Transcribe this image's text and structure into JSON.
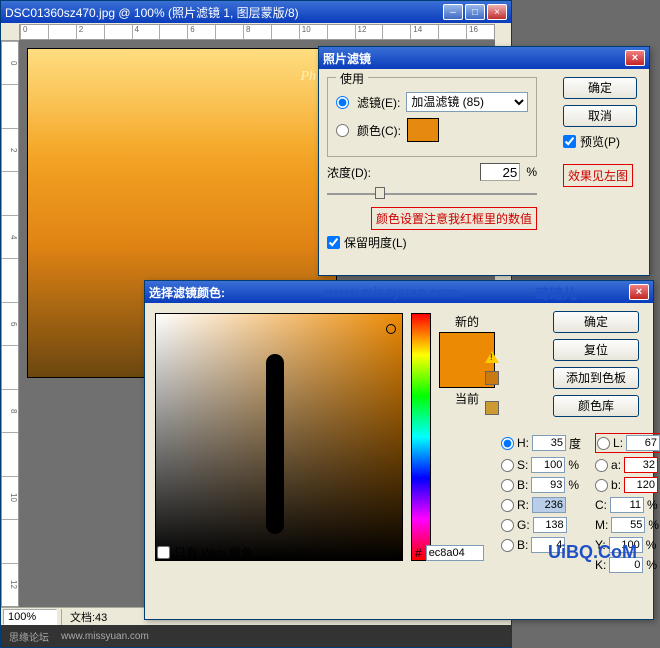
{
  "doc": {
    "title": "DSC01360sz470.jpg @ 100% (照片滤镜 1, 图层蒙版/8)",
    "zoom": "100%",
    "doc_info": "文档:43",
    "ruler_h": [
      "0",
      "",
      "2",
      "",
      "4",
      "",
      "6",
      "",
      "8",
      "",
      "10",
      "",
      "12",
      "",
      "14",
      "",
      "16"
    ],
    "ruler_v": [
      "0",
      "",
      "2",
      "",
      "4",
      "",
      "6",
      "",
      "8",
      "",
      "10",
      "",
      "12"
    ],
    "watermark": "Ph",
    "footer_left": "思缘论坛",
    "footer_right": "www.missyuan.com"
  },
  "photoFilter": {
    "title": "照片滤镜",
    "use_legend": "使用",
    "radio_filter": "滤镜(E):",
    "radio_color": "颜色(C):",
    "filter_selected": "加温滤镜 (85)",
    "density_label": "浓度(D):",
    "density_value": "25",
    "density_unit": "%",
    "preserve": "保留明度(L)",
    "ok": "确定",
    "cancel": "取消",
    "preview": "预览(P)",
    "note_effect": "效果见左图",
    "note_color": "颜色设置注意我红框里的数值"
  },
  "colorPicker": {
    "title": "选择滤镜颜色:",
    "url": "www.missyuan.com",
    "name": "琦琦儿",
    "new_label": "新的",
    "cur_label": "当前",
    "ok": "确定",
    "reset": "复位",
    "add_swatch": "添加到色板",
    "color_lib": "颜色库",
    "web_only": "只有 Web 颜色",
    "hex_label": "#",
    "hex_value": "ec8a04",
    "ubq": "UiBQ.CoM",
    "hsv": {
      "h_label": "H:",
      "h": "35",
      "h_unit": "度",
      "s_label": "S:",
      "s": "100",
      "s_unit": "%",
      "b_label": "B:",
      "b": "93",
      "b_unit": "%"
    },
    "lab": {
      "l_label": "L:",
      "l": "67",
      "a_label": "a:",
      "a": "32",
      "b_label": "b:",
      "b": "120"
    },
    "rgb": {
      "r_label": "R:",
      "r": "236",
      "g_label": "G:",
      "g": "138",
      "b_label": "B:",
      "b": "4"
    },
    "cmyk": {
      "c_label": "C:",
      "c": "11",
      "c_unit": "%",
      "m_label": "M:",
      "m": "55",
      "m_unit": "%",
      "y_label": "Y:",
      "y": "100",
      "y_unit": "%",
      "k_label": "K:",
      "k": "0",
      "k_unit": "%"
    }
  }
}
